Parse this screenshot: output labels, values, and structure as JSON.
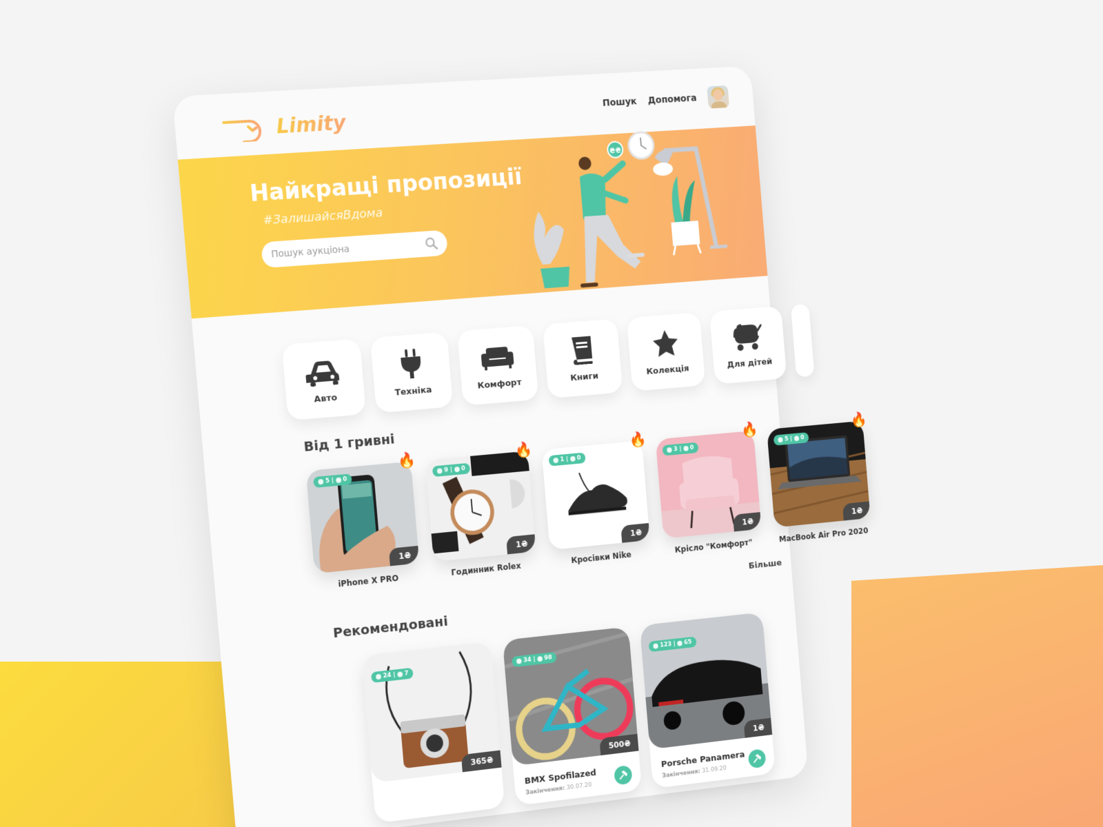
{
  "app": {
    "name": "Limity"
  },
  "nav": {
    "search": "Пошук",
    "help": "Допомога"
  },
  "hero": {
    "title": "Найкращі пропозиції",
    "hashtag": "#ЗалишайсяВдома",
    "search_placeholder": "Пошук аукціона",
    "coin_label": "₴₴"
  },
  "categories": [
    {
      "label": "Авто",
      "icon": "car-icon"
    },
    {
      "label": "Техніка",
      "icon": "plug-icon"
    },
    {
      "label": "Комфорт",
      "icon": "sofa-icon"
    },
    {
      "label": "Книги",
      "icon": "book-icon"
    },
    {
      "label": "Колекція",
      "icon": "star-icon"
    },
    {
      "label": "Для дітей",
      "icon": "stroller-icon"
    }
  ],
  "from_one": {
    "title": "Від 1 гривні",
    "more": "Більше",
    "items": [
      {
        "name": "iPhone X PRO",
        "participants": "5",
        "bids": "0",
        "price": "1₴",
        "hot": true
      },
      {
        "name": "Годинник Rolex",
        "participants": "9",
        "bids": "0",
        "price": "1₴",
        "hot": true
      },
      {
        "name": "Кросівки Nike",
        "participants": "1",
        "bids": "0",
        "price": "1₴",
        "hot": true
      },
      {
        "name": "Крісло \"Комфорт\"",
        "participants": "3",
        "bids": "0",
        "price": "1₴",
        "hot": true
      },
      {
        "name": "MacBook Air Pro 2020",
        "participants": "5",
        "bids": "0",
        "price": "1₴",
        "hot": true
      }
    ]
  },
  "recommended": {
    "title": "Рекомендовані",
    "ends_label": "Закінчення:",
    "items": [
      {
        "name": "",
        "participants": "24",
        "bids": "7",
        "price": "365₴",
        "ends": ""
      },
      {
        "name": "BMX Spofilazed",
        "participants": "34",
        "bids": "98",
        "price": "500₴",
        "ends": "30.07.20"
      },
      {
        "name": "Porsche Panamera",
        "participants": "123",
        "bids": "65",
        "price": "1₴",
        "ends": "31.09.20"
      }
    ]
  },
  "colors": {
    "accent": "#4fc5a5",
    "yellow": "#fcd64a",
    "orange": "#f9ab74",
    "dark": "#4a4a4a"
  }
}
